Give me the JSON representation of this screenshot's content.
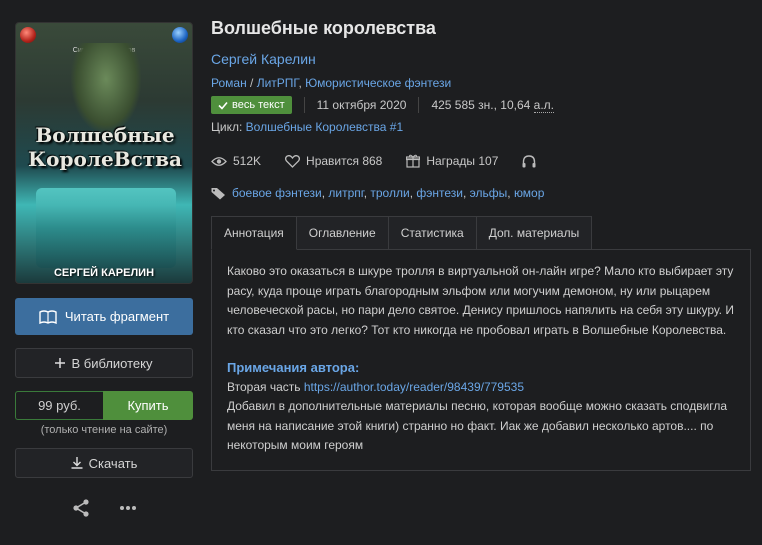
{
  "book": {
    "title": "Волшебные королевства",
    "author": "Сергей Карелин",
    "genres": [
      "Роман",
      "ЛитРПГ",
      "Юмористическое фэнтези"
    ],
    "genre_sep": " / ",
    "genre_comma": ", ",
    "status_badge": "весь текст",
    "date": "11 октября 2020",
    "size_prefix": "425 585 зн., 10,64 ",
    "size_unit": "а.л.",
    "cycle_label": "Цикл:",
    "cycle_name": "Волшебные Королевства #1"
  },
  "cover": {
    "title_line1": "Волшебные",
    "title_line2": "КоролеВства",
    "author_art": "СЕРГЕЙ КАРЕЛИН",
    "small_text": "Симфонія Облаков"
  },
  "stats": {
    "views": "512K",
    "likes": "Нравится 868",
    "awards": "Награды 107"
  },
  "tags": [
    "боевое фэнтези",
    "литрпг",
    "тролли",
    "фэнтези",
    "эльфы",
    "юмор"
  ],
  "tabs": [
    "Аннотация",
    "Оглавление",
    "Статистика",
    "Доп. материалы"
  ],
  "annotation": {
    "text": "Каково это оказаться в шкуре тролля в виртуальной он-лайн игре? Мало кто выбирает эту расу, куда проще играть благородным эльфом или могучим демоном, ну или рыцарем человеческой расы, но пари дело святое. Денису пришлось напялить на себя эту шкуру. И кто сказал что это легко? Тот кто никогда не пробовал играть в Волшебные Королевства.",
    "notes_title": "Примечания автора:",
    "notes_line1_prefix": "Вторая часть ",
    "notes_link": "https://author.today/reader/98439/779535",
    "notes_rest": "Добавил в дополнительные материалы песню, которая вообще можно сказать сподвигла меня на написание этой книги) странно но факт. Иак же добавил несколько артов.... по некоторым моим героям"
  },
  "actions": {
    "read": "Читать фрагмент",
    "library": "В библиотеку",
    "price": "99 руб.",
    "buy": "Купить",
    "buy_note": "(только чтение на сайте)",
    "download": "Скачать"
  },
  "colors": {
    "accent_blue": "#6aa6e6",
    "read_button": "#3c6e9e",
    "buy_green": "#4f8f3c",
    "background": "#1d1e20"
  }
}
